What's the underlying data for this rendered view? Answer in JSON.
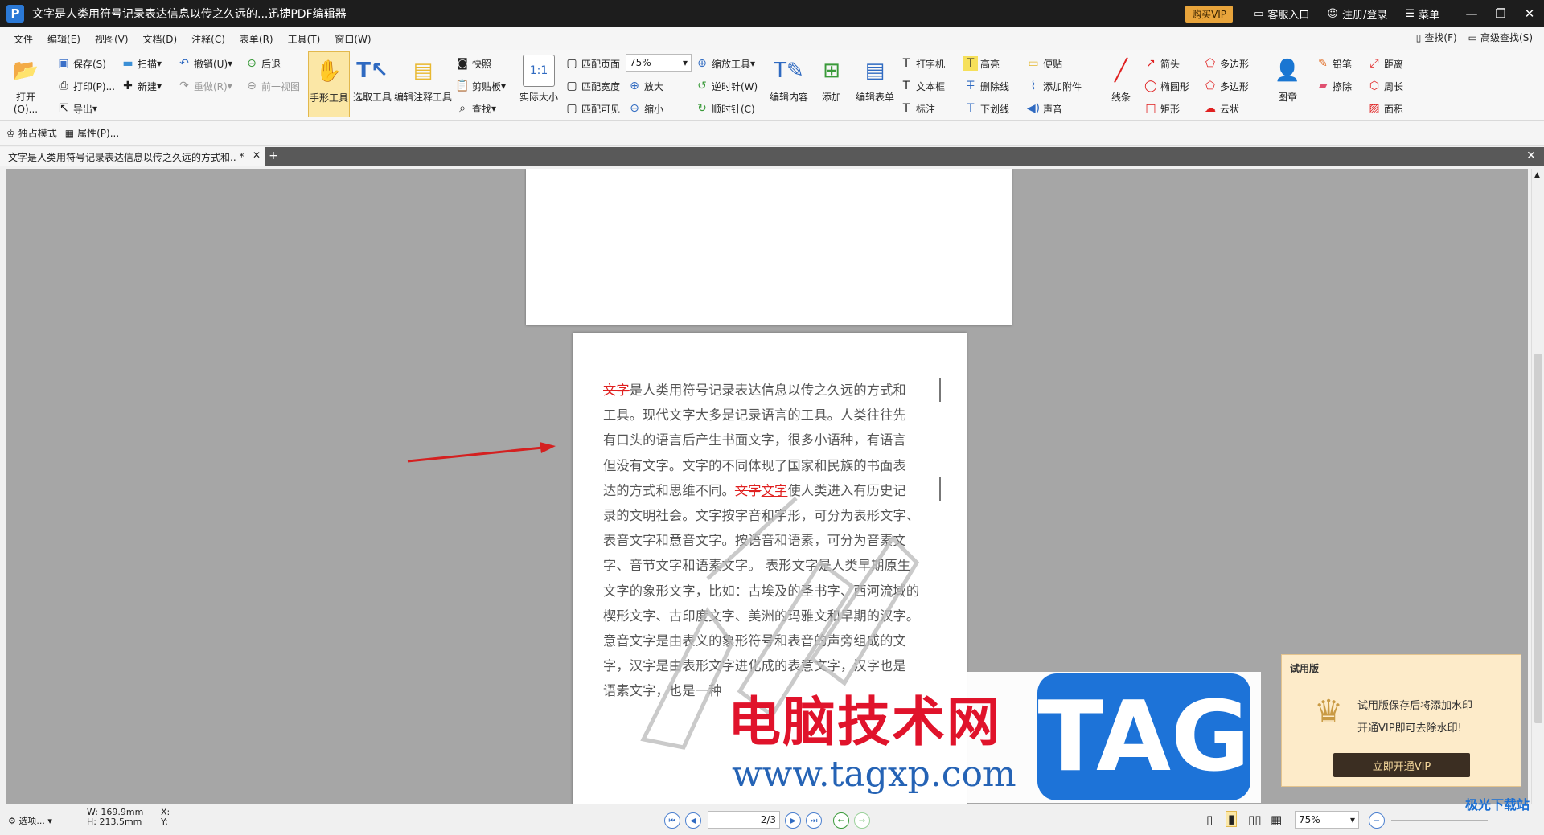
{
  "titlebar": {
    "title": "文字是人类用符号记录表达信息以传之久远的...迅捷PDF编辑器",
    "buy_vip": "购买VIP",
    "service": "客服入口",
    "login": "注册/登录",
    "menu": "菜单"
  },
  "menubar": {
    "items": [
      "文件",
      "编辑(E)",
      "视图(V)",
      "文档(D)",
      "注释(C)",
      "表单(R)",
      "工具(T)",
      "窗口(W)"
    ],
    "find": "查找(F)",
    "advanced_find": "高级查找(S)"
  },
  "ribbon": {
    "open": "打开(O)...",
    "save": "保存(S)",
    "print": "打印(P)...",
    "export": "导出",
    "scan": "扫描",
    "new": "新建",
    "undo": "撤销(U)",
    "redo": "重做(R)",
    "back": "后退",
    "prev_view": "前一视图",
    "hand_tool": "手形工具",
    "select_tool": "选取工具",
    "edit_annot_tool": "编辑注释工具",
    "snapshot": "快照",
    "clipboard": "剪贴板",
    "find": "查找",
    "actual_size": "实际大小",
    "fit_page": "匹配页面",
    "fit_width": "匹配宽度",
    "fit_visible": "匹配可见",
    "zoom_value": "75%",
    "zoom_tool": "缩放工具",
    "zoom_in": "放大",
    "zoom_out": "缩小",
    "rotate_ccw": "逆时针(W)",
    "rotate_cw": "顺时针(C)",
    "edit_content": "编辑内容",
    "add": "添加",
    "edit_form": "编辑表单",
    "typewriter": "打字机",
    "textbox": "文本框",
    "callout": "标注",
    "highlight": "高亮",
    "strikeout": "删除线",
    "underline": "下划线",
    "note": "便贴",
    "attach": "添加附件",
    "sound": "声音",
    "line": "线条",
    "arrow": "箭头",
    "ellipse": "椭圆形",
    "rect": "矩形",
    "polygon": "多边形",
    "polyline": "多边形",
    "cloud": "云状",
    "stamp": "图章",
    "pencil": "铅笔",
    "eraser": "擦除",
    "distance": "距离",
    "perimeter": "周长",
    "area": "面积"
  },
  "subbar": {
    "exclusive_mode": "独占模式",
    "properties": "属性(P)..."
  },
  "tab": {
    "label": "文字是人类用符号记录表达信息以传之久远的方式和..",
    "modified": "*"
  },
  "document": {
    "lines": [
      {
        "pre_strike": "文字",
        "text": "是人类用符号记录表达信息以传之久远的方式和"
      },
      {
        "text": "工具。现代文字大多是记录语言的工具。人类往往先"
      },
      {
        "text": "有口头的语言后产生书面文字，很多小语种，有语言"
      },
      {
        "text": "但没有文字。文字的不同体现了国家和民族的书面表"
      },
      {
        "text": "达的方式和思维不同。",
        "strike": "文字",
        "under": "文字",
        "post": "使人类进入有历史记"
      },
      {
        "text": "录的文明社会。文字按字音和字形，可分为表形文字、"
      },
      {
        "text": "表音文字和意音文字。按语音和语素，可分为音素文"
      },
      {
        "text": "字、音节文字和语素文字。 表形文字是人类早期原生"
      },
      {
        "text": "文字的象形文字，比如：古埃及的圣书字、西河流域的"
      },
      {
        "text": "楔形文字、古印度文字、美洲的玛雅文和早期的汉字。"
      },
      {
        "text": "意音文字是由表义的象形符号和表音的声旁组成的文"
      },
      {
        "text": "字，汉字是由表形文字进化成的表意文字，汉字也是"
      },
      {
        "text": "语素文字，也是一种"
      }
    ]
  },
  "watermark": {
    "site_name": "电脑技术网",
    "url": "www.tagxp.com",
    "tag": "TAG"
  },
  "trial": {
    "title": "试用版",
    "line1": "试用版保存后将添加水印",
    "line2": "开通VIP即可去除水印!",
    "button": "立即开通VIP"
  },
  "statusbar": {
    "options": "选项...",
    "w": "W: 169.9mm",
    "h": "H: 213.5mm",
    "x": "X:",
    "y": "Y:",
    "page": "2/3",
    "zoom": "75%"
  },
  "corner_logo": "极光下载站"
}
